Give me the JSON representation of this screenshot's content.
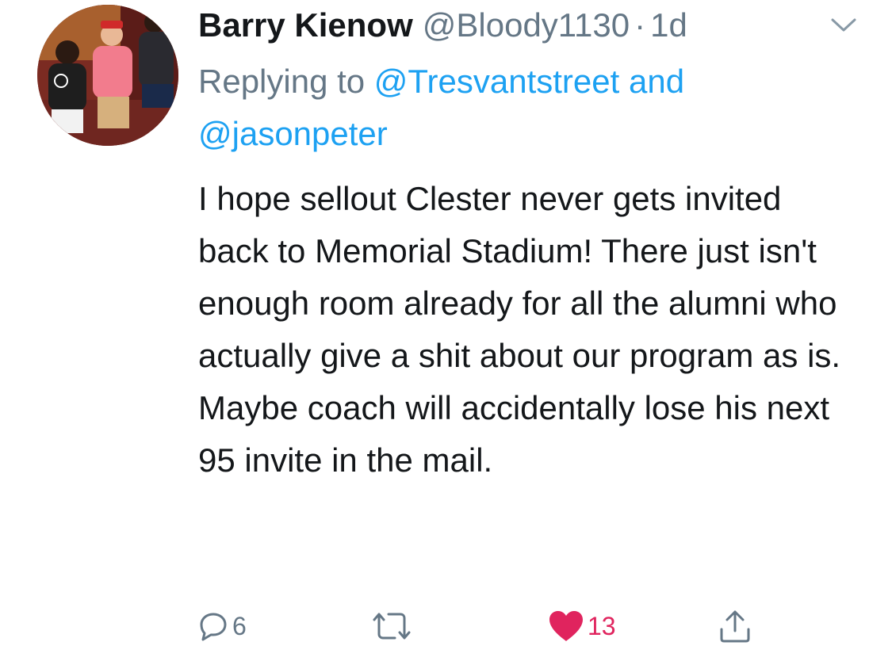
{
  "tweet": {
    "display_name": "Barry Kienow",
    "handle": "@Bloody1130",
    "separator": "·",
    "time": "1d",
    "reply_prefix": "Replying to",
    "reply_mention_1": "@Tresvantstreet",
    "reply_joiner": "and",
    "reply_mention_2": "@jasonpeter",
    "text": "I hope sellout Clester never gets invited back to Memorial Stadium! There just isn't enough room already for all the alumni who actually give a shit about our program as is. Maybe coach will accidentally lose his next 95 invite in the mail."
  },
  "actions": {
    "reply_icon": "reply-bubble-icon",
    "reply_count": "6",
    "retweet_icon": "retweet-arrows-icon",
    "like_icon": "heart-icon",
    "like_count": "13",
    "share_icon": "share-upload-icon"
  },
  "colors": {
    "text": "#14171a",
    "secondary": "#657786",
    "link": "#1da1f2",
    "like": "#e0245e"
  }
}
